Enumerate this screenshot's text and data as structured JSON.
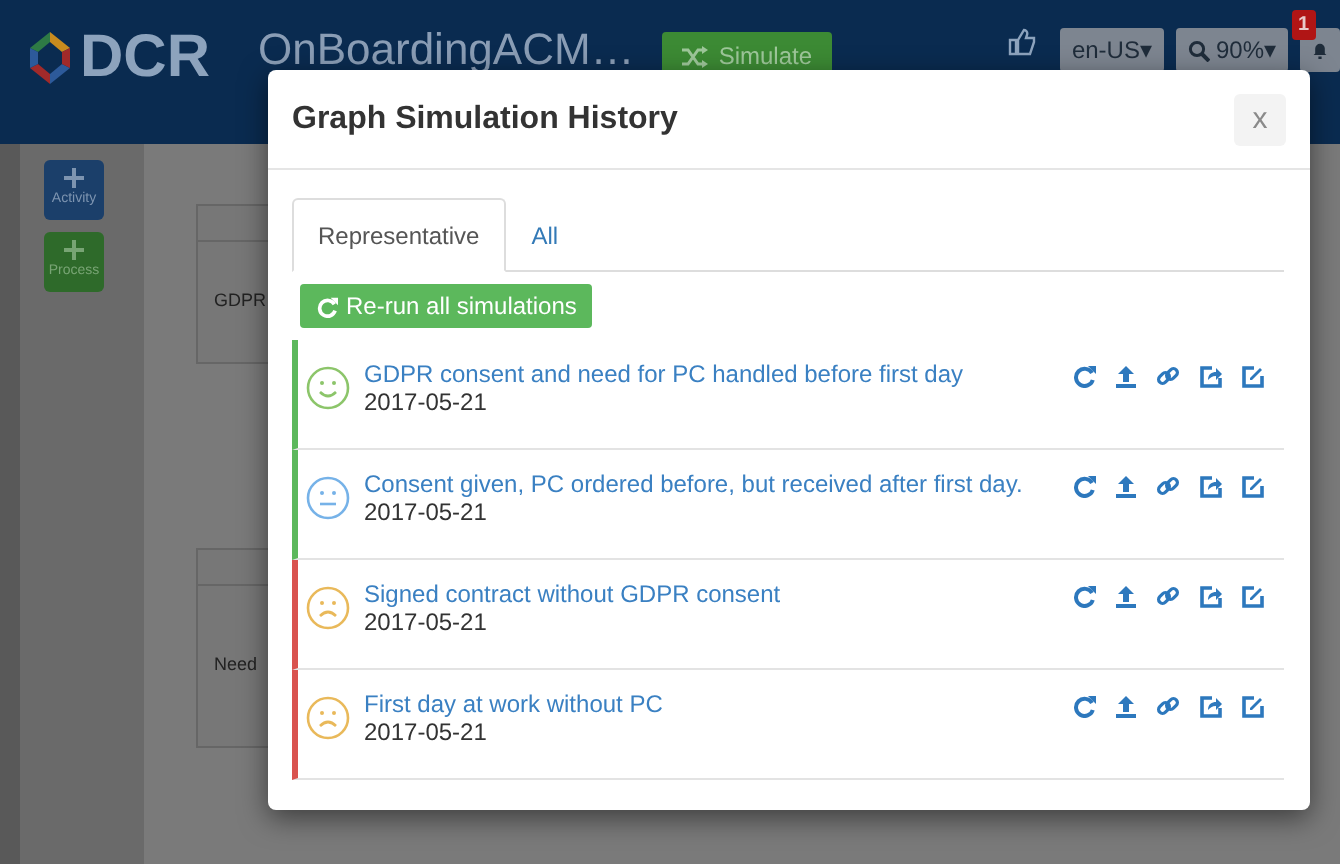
{
  "header": {
    "logo": "DCR",
    "graph_title": "OnBoardingACM…",
    "simulate": "Simulate",
    "language": "en-US▾",
    "zoom": "90%▾",
    "notification_count": "1"
  },
  "toolbox": [
    {
      "label": "Activity",
      "kind": "activity"
    },
    {
      "label": "Process",
      "kind": "process"
    }
  ],
  "canvas": {
    "boxes": [
      {
        "body": "GDPR"
      },
      {
        "body": "Need"
      }
    ]
  },
  "modal": {
    "title": "Graph Simulation History",
    "close": "x",
    "tabs": [
      {
        "label": "Representative",
        "selected": true
      },
      {
        "label": "All",
        "selected": false
      }
    ],
    "rerun_button": "Re-run all simulations",
    "simulations": [
      {
        "title": "GDPR consent and need for PC handled before first day",
        "date": "2017-05-21",
        "kind": "happy",
        "passed": true
      },
      {
        "title": "Consent given, PC ordered before, but received after first day.",
        "date": "2017-05-21",
        "kind": "neutral",
        "passed": true
      },
      {
        "title": "Signed contract without GDPR consent",
        "date": "2017-05-21",
        "kind": "sad",
        "passed": false
      },
      {
        "title": "First day at work without PC",
        "date": "2017-05-21",
        "kind": "sad",
        "passed": false
      }
    ]
  }
}
